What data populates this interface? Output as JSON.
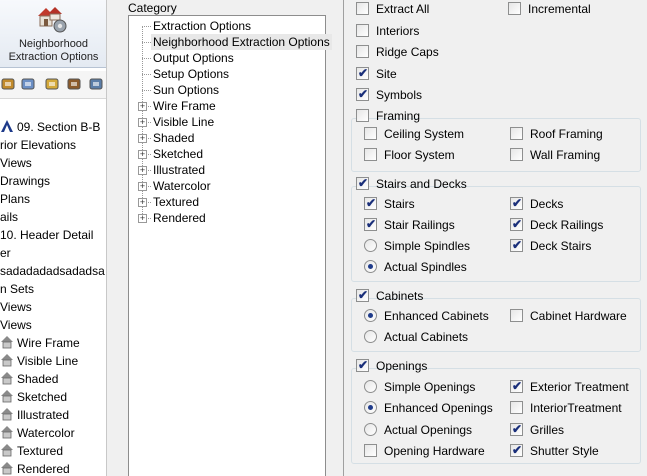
{
  "ribbon": {
    "line1": "Neighborhood",
    "line2": "Extraction Options"
  },
  "toolbar": {
    "icons": [
      "tool-icon-1",
      "tool-icon-2",
      "tool-icon-3",
      "tool-icon-4",
      "tool-icon-5"
    ]
  },
  "project": {
    "items": [
      {
        "label": "09. Section B-B",
        "icon": "section-icon",
        "colored": true
      },
      {
        "label": "rior Elevations"
      },
      {
        "label": "Views"
      },
      {
        "label": "Drawings"
      },
      {
        "label": "Plans"
      },
      {
        "label": "ails"
      },
      {
        "label": "10. Header Detail"
      },
      {
        "label": "er"
      },
      {
        "label": "sadadadadsadadsa"
      },
      {
        "label": "n Sets"
      },
      {
        "label": "Views"
      },
      {
        "label": "Views"
      },
      {
        "label": "Wire Frame",
        "icon": "house-icon"
      },
      {
        "label": "Visible Line",
        "icon": "house-icon"
      },
      {
        "label": "Shaded",
        "icon": "house-icon"
      },
      {
        "label": "Sketched",
        "icon": "house-icon"
      },
      {
        "label": "Illustrated",
        "icon": "house-icon"
      },
      {
        "label": "Watercolor",
        "icon": "house-icon"
      },
      {
        "label": "Textured",
        "icon": "house-icon"
      },
      {
        "label": "Rendered",
        "icon": "house-icon"
      }
    ]
  },
  "category": {
    "label": "Category",
    "items": [
      {
        "label": "Extraction Options",
        "expandable": false
      },
      {
        "label": "Neighborhood Extraction Options",
        "expandable": false,
        "selected": true
      },
      {
        "label": "Output Options",
        "expandable": false
      },
      {
        "label": "Setup Options",
        "expandable": false
      },
      {
        "label": "Sun Options",
        "expandable": false
      },
      {
        "label": "Wire Frame",
        "expandable": true
      },
      {
        "label": "Visible Line",
        "expandable": true
      },
      {
        "label": "Shaded",
        "expandable": true
      },
      {
        "label": "Sketched",
        "expandable": true
      },
      {
        "label": "Illustrated",
        "expandable": true
      },
      {
        "label": "Watercolor",
        "expandable": true
      },
      {
        "label": "Textured",
        "expandable": true
      },
      {
        "label": "Rendered",
        "expandable": true
      }
    ]
  },
  "options": {
    "extract_all": {
      "label": "Extract All",
      "checked": false
    },
    "incremental": {
      "label": "Incremental",
      "checked": false
    },
    "interiors": {
      "label": "Interiors",
      "checked": false
    },
    "ridge_caps": {
      "label": "Ridge Caps",
      "checked": false
    },
    "site": {
      "label": "Site",
      "checked": true
    },
    "symbols": {
      "label": "Symbols",
      "checked": true
    },
    "framing": {
      "label": "Framing",
      "checked": false,
      "ceiling_system": {
        "label": "Ceiling System",
        "checked": false
      },
      "roof_framing": {
        "label": "Roof Framing",
        "checked": false
      },
      "floor_system": {
        "label": "Floor System",
        "checked": false
      },
      "wall_framing": {
        "label": "Wall Framing",
        "checked": false
      }
    },
    "stairs_decks": {
      "label": "Stairs and Decks",
      "checked": true,
      "stairs": {
        "label": "Stairs",
        "checked": true
      },
      "decks": {
        "label": "Decks",
        "checked": true
      },
      "stair_railings": {
        "label": "Stair Railings",
        "checked": true
      },
      "deck_railings": {
        "label": "Deck Railings",
        "checked": true
      },
      "simple_spindles": {
        "label": "Simple Spindles",
        "selected": false
      },
      "deck_stairs": {
        "label": "Deck Stairs",
        "checked": true
      },
      "actual_spindles": {
        "label": "Actual Spindles",
        "selected": true
      }
    },
    "cabinets": {
      "label": "Cabinets",
      "checked": true,
      "enhanced_cabinets": {
        "label": "Enhanced Cabinets",
        "selected": true
      },
      "cabinet_hardware": {
        "label": "Cabinet Hardware",
        "checked": false
      },
      "actual_cabinets": {
        "label": "Actual Cabinets",
        "selected": false
      }
    },
    "openings": {
      "label": "Openings",
      "checked": true,
      "simple_openings": {
        "label": "Simple Openings",
        "selected": false
      },
      "exterior_treatment": {
        "label": "Exterior Treatment",
        "checked": true
      },
      "enhanced_openings": {
        "label": "Enhanced Openings",
        "selected": true
      },
      "interior_treatment": {
        "label": "InteriorTreatment",
        "checked": false
      },
      "actual_openings": {
        "label": "Actual Openings",
        "selected": false
      },
      "grilles": {
        "label": "Grilles",
        "checked": true
      },
      "opening_hardware": {
        "label": "Opening Hardware",
        "checked": false
      },
      "shutter_style": {
        "label": "Shutter Style",
        "checked": true
      }
    }
  }
}
